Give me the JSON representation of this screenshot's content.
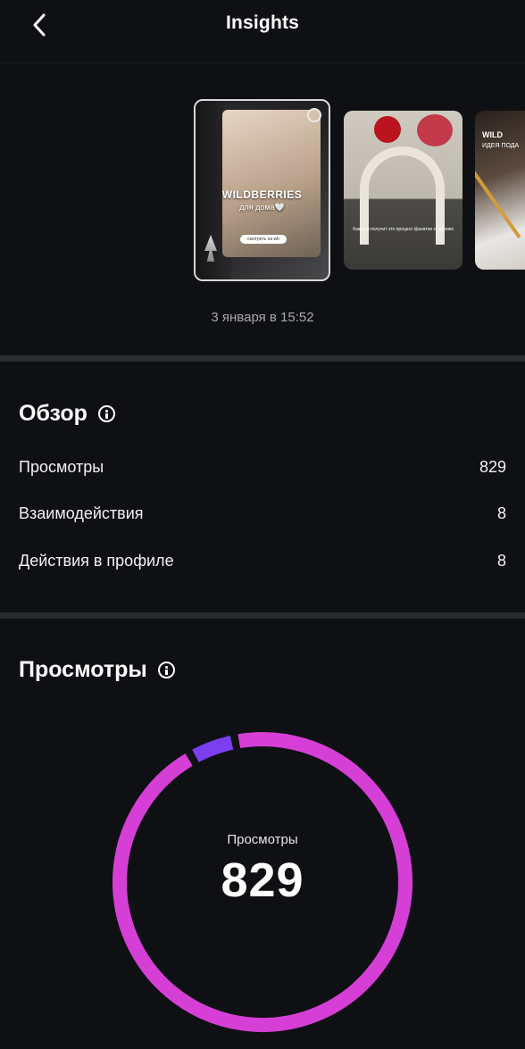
{
  "header": {
    "title": "Insights",
    "back_icon": "chevron-left-icon"
  },
  "thumbnails": [
    {
      "brand": "WILDBERRIES",
      "sub": "для дома🤍",
      "button": "смотреть на wb"
    },
    {
      "caption": "Каждый получит это процесс фанатов заполним"
    },
    {
      "line1": "WILD",
      "line2": "ИДЕЯ ПОДА"
    }
  ],
  "date": "3 января в 15:52",
  "overview": {
    "title": "Обзор",
    "rows": [
      {
        "label": "Просмотры",
        "value": "829"
      },
      {
        "label": "Взаимодействия",
        "value": "8"
      },
      {
        "label": "Действия в профиле",
        "value": "8"
      }
    ]
  },
  "views": {
    "title": "Просмотры",
    "donut_label": "Просмотры",
    "donut_value": "829"
  },
  "chart_data": {
    "type": "pie",
    "total": 829,
    "segments": [
      {
        "share": 0.92,
        "color": "#d63fd6"
      },
      {
        "share": 0.05,
        "color": "#7b3ef0"
      }
    ]
  }
}
